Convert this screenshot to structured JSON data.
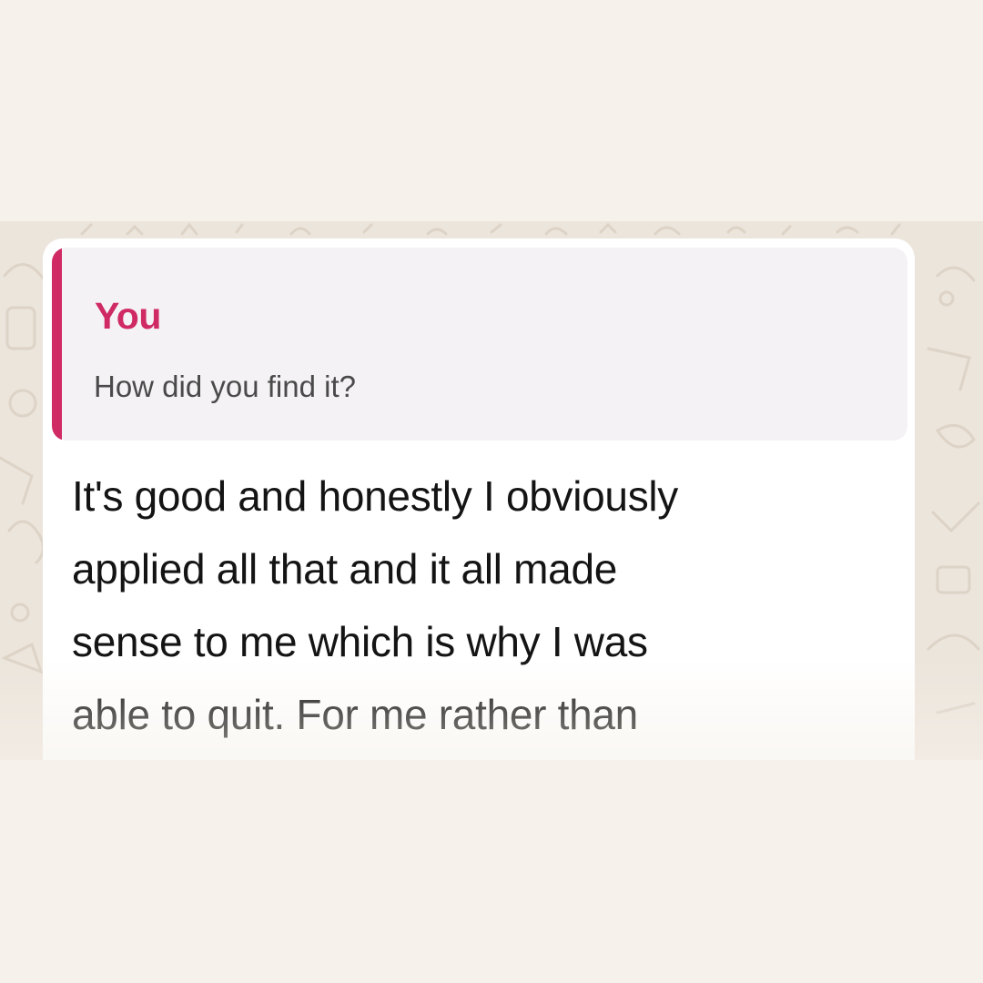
{
  "quoted_message": {
    "author": "You",
    "text": "How did you find it?",
    "accent_color": "#cf2a64"
  },
  "message": {
    "lines": [
      "It's good and honestly I obviously",
      "applied all that and it all made",
      "sense to me which is why I was",
      "able to quit. For me rather than"
    ]
  },
  "colors": {
    "page_background": "#f6f1ea",
    "chat_wallpaper": "#ece5dc",
    "bubble": "#ffffff",
    "quote_background": "#f4f2f4"
  }
}
